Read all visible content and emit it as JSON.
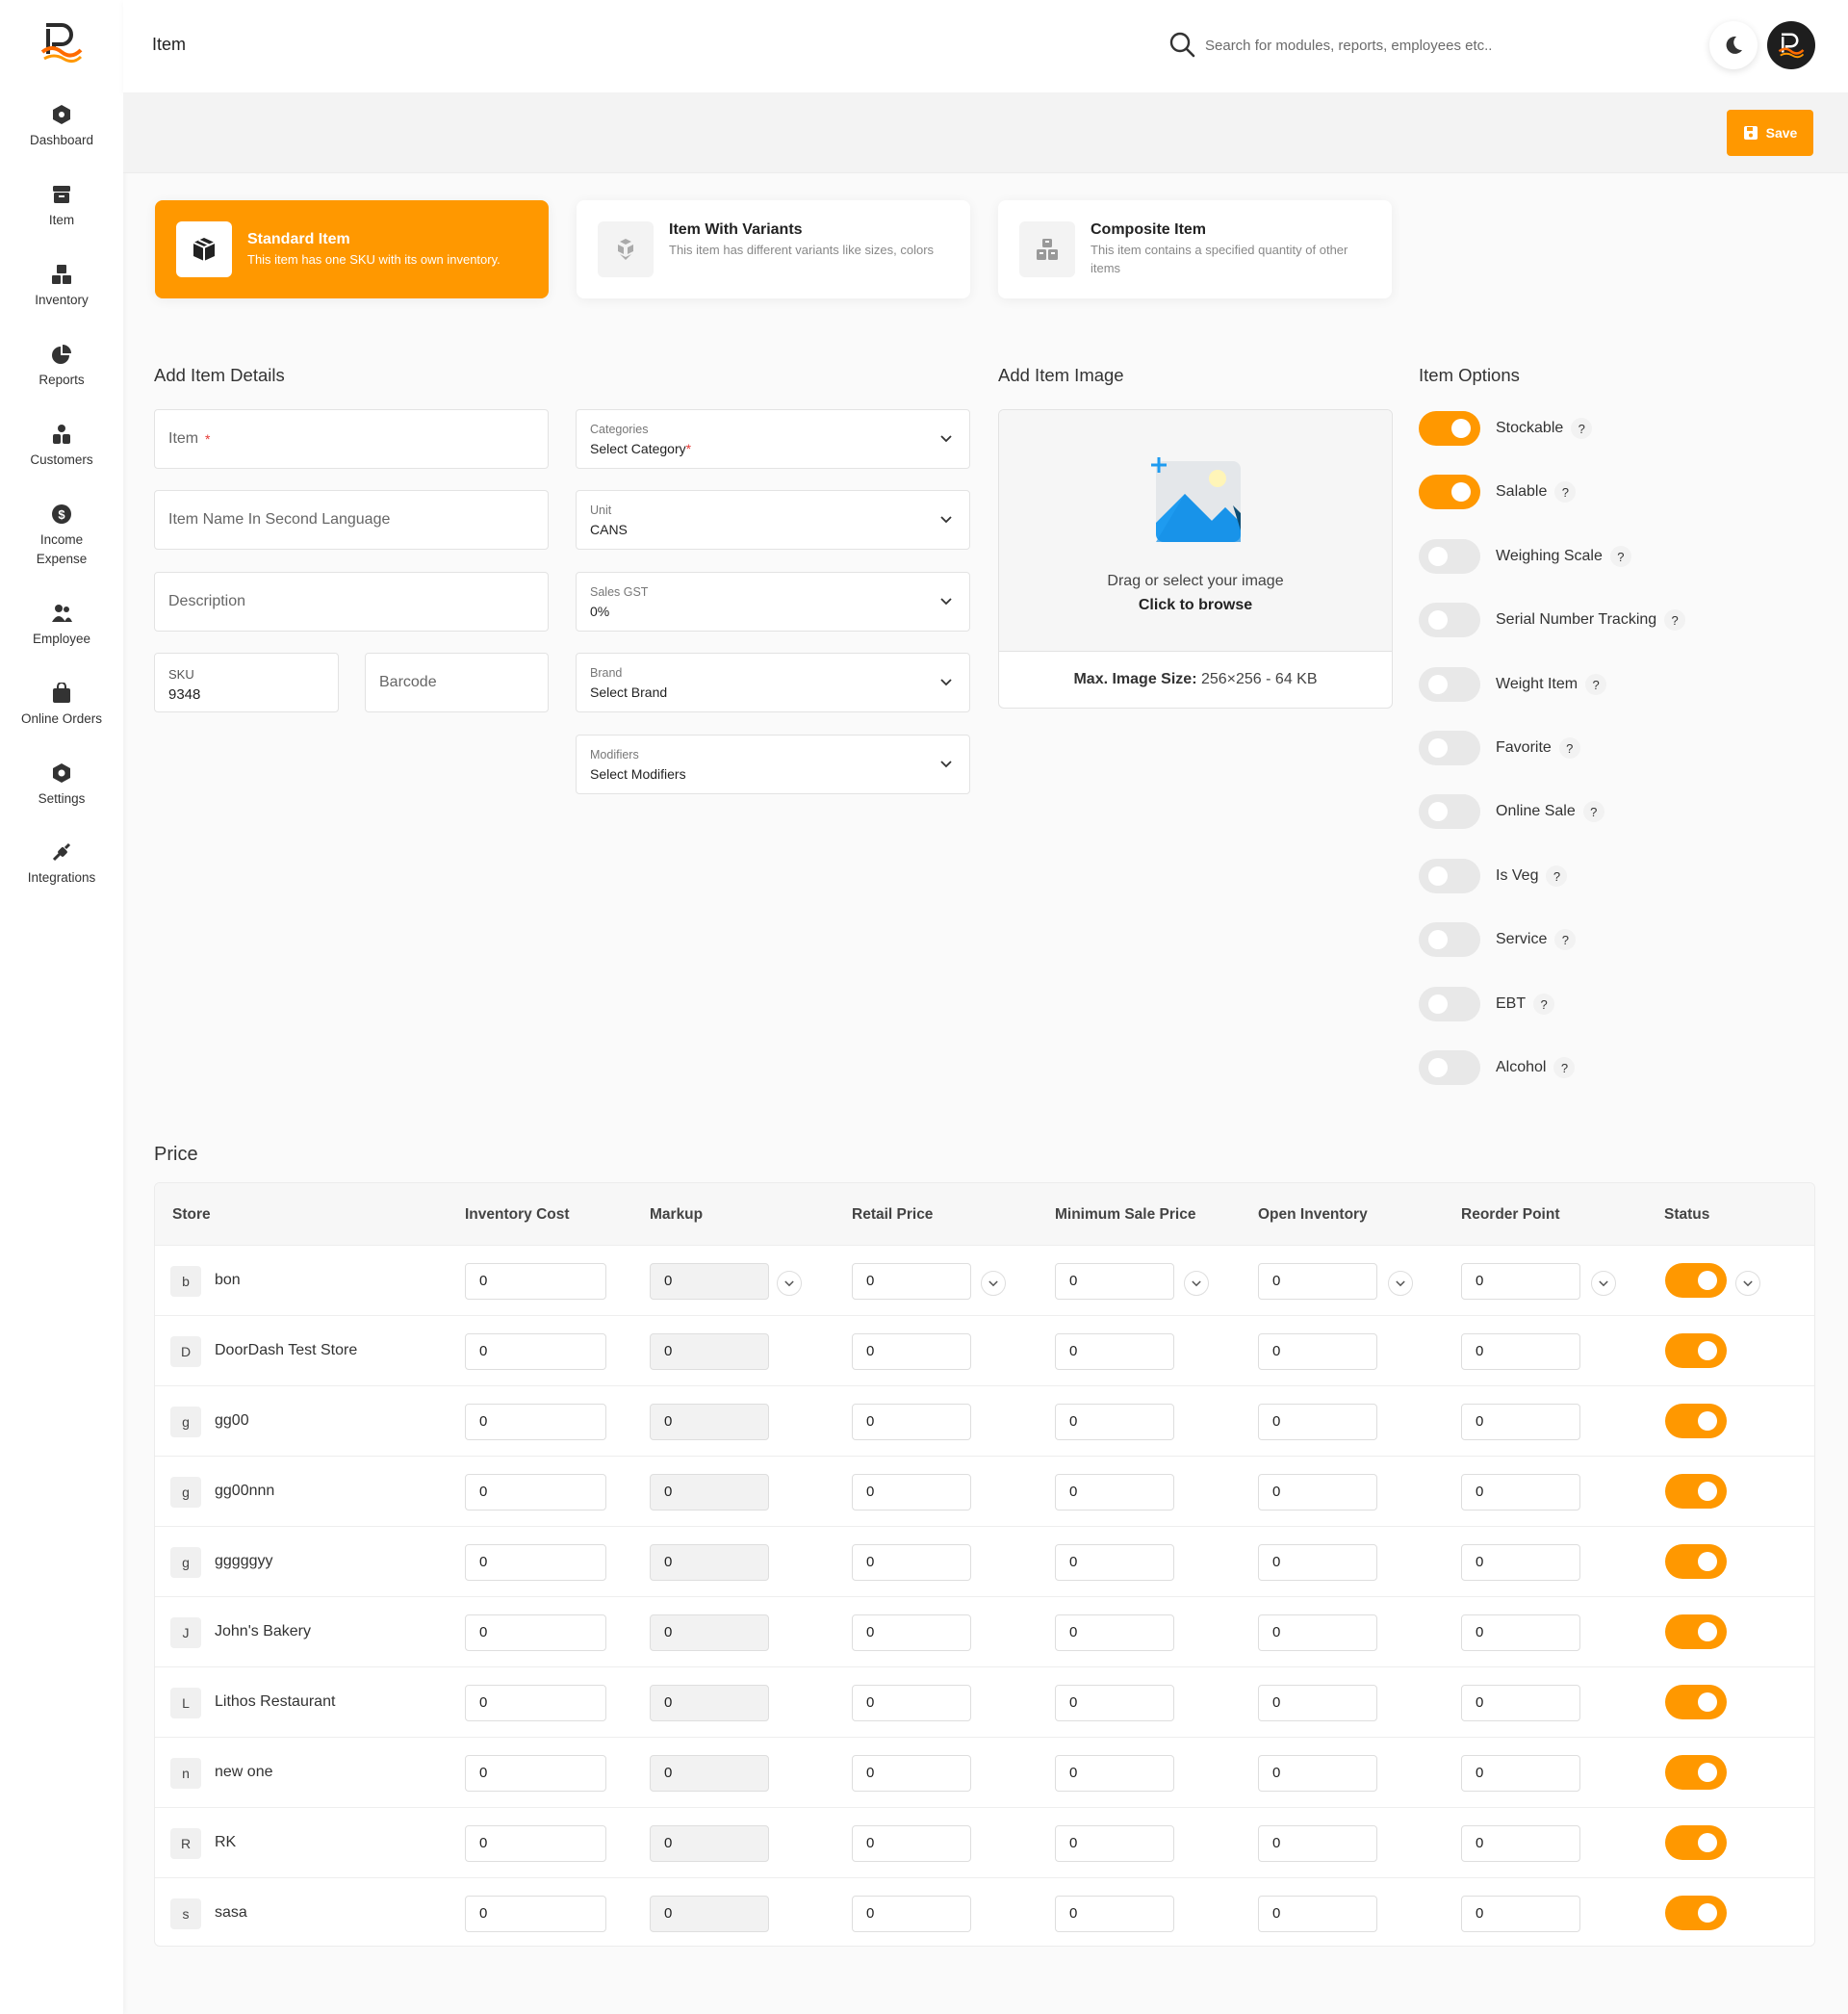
{
  "sidebar": {
    "items": [
      {
        "label": "Dashboard",
        "icon": "dashboard-icon"
      },
      {
        "label": "Item",
        "icon": "item-icon"
      },
      {
        "label": "Inventory",
        "icon": "inventory-icon"
      },
      {
        "label": "Reports",
        "icon": "reports-icon"
      },
      {
        "label": "Customers",
        "icon": "customers-icon"
      },
      {
        "label": "Income Expense",
        "icon": "income-expense-icon"
      },
      {
        "label": "Employee",
        "icon": "employee-icon"
      },
      {
        "label": "Online Orders",
        "icon": "online-orders-icon"
      },
      {
        "label": "Settings",
        "icon": "settings-icon"
      },
      {
        "label": "Integrations",
        "icon": "integrations-icon"
      }
    ]
  },
  "header": {
    "title": "Item",
    "search_placeholder": "Search for modules, reports, employees etc.."
  },
  "toolbar": {
    "save_label": "Save"
  },
  "item_types": [
    {
      "title": "Standard Item",
      "desc": "This item has one SKU with its own inventory.",
      "active": true
    },
    {
      "title": "Item With Variants",
      "desc": "This item has different variants like sizes, colors",
      "active": false
    },
    {
      "title": "Composite Item",
      "desc": "This item contains a specified quantity of other items",
      "active": false
    }
  ],
  "details": {
    "title": "Add Item Details",
    "item_placeholder": "Item",
    "item_required": "*",
    "second_lang_placeholder": "Item Name In Second Language",
    "description_placeholder": "Description",
    "sku_label": "SKU",
    "sku_value": "9348",
    "barcode_placeholder": "Barcode",
    "categories_label": "Categories",
    "categories_value": "Select Category",
    "categories_required": "*",
    "unit_label": "Unit",
    "unit_value": "CANS",
    "gst_label": "Sales GST",
    "gst_value": "0%",
    "brand_label": "Brand",
    "brand_value": "Select Brand",
    "modifiers_label": "Modifiers",
    "modifiers_value": "Select Modifiers"
  },
  "image": {
    "title": "Add Item Image",
    "drag_text": "Drag or select your image",
    "browse_text": "Click to browse",
    "max_label": "Max. Image Size:",
    "max_value": "256×256 - 64 KB"
  },
  "options": {
    "title": "Item Options",
    "help_symbol": "?",
    "items": [
      {
        "label": "Stockable",
        "on": true
      },
      {
        "label": "Salable",
        "on": true
      },
      {
        "label": "Weighing Scale",
        "on": false
      },
      {
        "label": "Serial Number Tracking",
        "on": false
      },
      {
        "label": "Weight Item",
        "on": false
      },
      {
        "label": "Favorite",
        "on": false
      },
      {
        "label": "Online Sale",
        "on": false
      },
      {
        "label": "Is Veg",
        "on": false
      },
      {
        "label": "Service",
        "on": false
      },
      {
        "label": "EBT",
        "on": false
      },
      {
        "label": "Alcohol",
        "on": false
      }
    ]
  },
  "price": {
    "title": "Price",
    "columns": [
      "Store",
      "Inventory Cost",
      "Markup",
      "Retail Price",
      "Minimum Sale Price",
      "Open Inventory",
      "Reorder Point",
      "Status"
    ],
    "rows": [
      {
        "badge": "b",
        "store": "bon",
        "inventory_cost": "0",
        "markup": "0",
        "retail_price": "0",
        "min_sale_price": "0",
        "open_inventory": "0",
        "reorder_point": "0",
        "status": true
      },
      {
        "badge": "D",
        "store": "DoorDash Test Store",
        "inventory_cost": "0",
        "markup": "0",
        "retail_price": "0",
        "min_sale_price": "0",
        "open_inventory": "0",
        "reorder_point": "0",
        "status": true
      },
      {
        "badge": "g",
        "store": "gg00",
        "inventory_cost": "0",
        "markup": "0",
        "retail_price": "0",
        "min_sale_price": "0",
        "open_inventory": "0",
        "reorder_point": "0",
        "status": true
      },
      {
        "badge": "g",
        "store": "gg00nnn",
        "inventory_cost": "0",
        "markup": "0",
        "retail_price": "0",
        "min_sale_price": "0",
        "open_inventory": "0",
        "reorder_point": "0",
        "status": true
      },
      {
        "badge": "g",
        "store": "gggggyy",
        "inventory_cost": "0",
        "markup": "0",
        "retail_price": "0",
        "min_sale_price": "0",
        "open_inventory": "0",
        "reorder_point": "0",
        "status": true
      },
      {
        "badge": "J",
        "store": "John's Bakery",
        "inventory_cost": "0",
        "markup": "0",
        "retail_price": "0",
        "min_sale_price": "0",
        "open_inventory": "0",
        "reorder_point": "0",
        "status": true
      },
      {
        "badge": "L",
        "store": "Lithos Restaurant",
        "inventory_cost": "0",
        "markup": "0",
        "retail_price": "0",
        "min_sale_price": "0",
        "open_inventory": "0",
        "reorder_point": "0",
        "status": true
      },
      {
        "badge": "n",
        "store": "new one",
        "inventory_cost": "0",
        "markup": "0",
        "retail_price": "0",
        "min_sale_price": "0",
        "open_inventory": "0",
        "reorder_point": "0",
        "status": true
      },
      {
        "badge": "R",
        "store": "RK",
        "inventory_cost": "0",
        "markup": "0",
        "retail_price": "0",
        "min_sale_price": "0",
        "open_inventory": "0",
        "reorder_point": "0",
        "status": true
      },
      {
        "badge": "s",
        "store": "sasa",
        "inventory_cost": "0",
        "markup": "0",
        "retail_price": "0",
        "min_sale_price": "0",
        "open_inventory": "0",
        "reorder_point": "0",
        "status": true
      }
    ]
  },
  "colors": {
    "accent": "#ff9800",
    "toggle_off": "#e8e8e8",
    "required": "#e53935"
  }
}
